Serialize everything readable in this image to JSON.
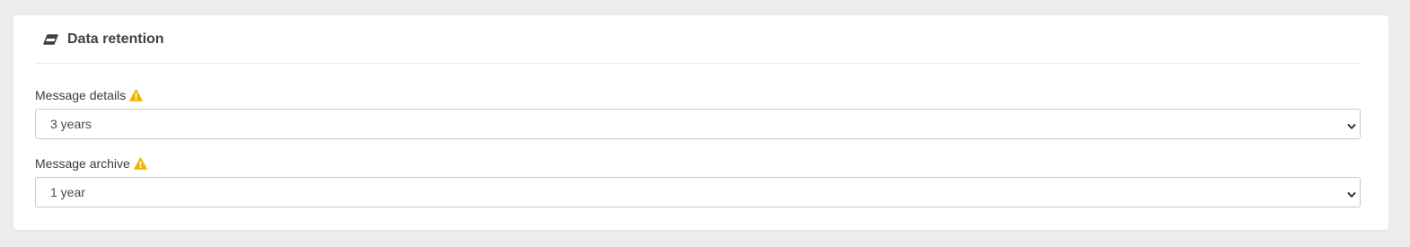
{
  "section": {
    "title": "Data retention",
    "icon": "eraser-icon"
  },
  "fields": [
    {
      "label": "Message details",
      "icon": "warning-icon",
      "selected": "3 years"
    },
    {
      "label": "Message archive",
      "icon": "warning-icon",
      "selected": "1 year"
    }
  ],
  "colors": {
    "warning": "#f0b400",
    "background": "#ececec",
    "card": "#ffffff"
  }
}
